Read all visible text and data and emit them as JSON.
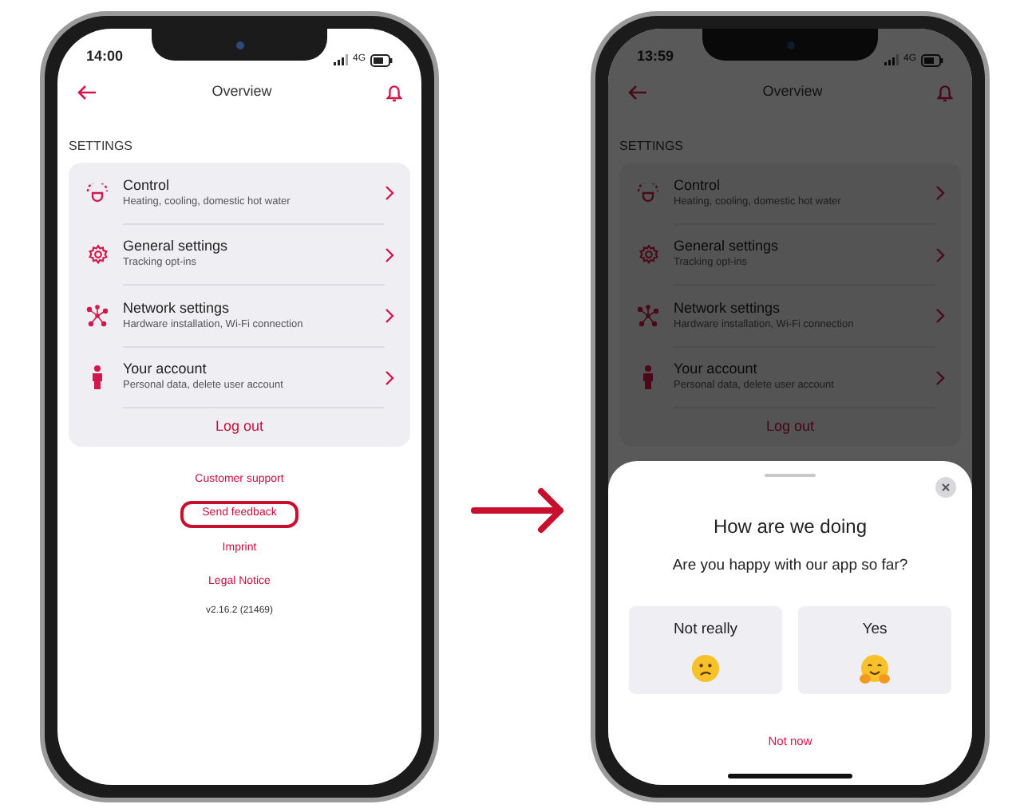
{
  "phones": [
    {
      "status_bar": {
        "time": "14:00",
        "network": "4G"
      },
      "dimmed": false,
      "nav": {
        "title": "Overview"
      },
      "section": "SETTINGS",
      "items": [
        {
          "kind": "control",
          "title": "Control",
          "subtitle": "Heating, cooling, domestic hot water"
        },
        {
          "kind": "general",
          "title": "General settings",
          "subtitle": "Tracking opt-ins"
        },
        {
          "kind": "network",
          "title": "Network settings",
          "subtitle": "Hardware installation, Wi-Fi connection"
        },
        {
          "kind": "account",
          "title": "Your account",
          "subtitle": "Personal data, delete user account"
        }
      ],
      "logout": "Log out",
      "links": [
        {
          "label": "Customer support",
          "highlighted": false
        },
        {
          "label": "Send feedback",
          "highlighted": true
        },
        {
          "label": "Imprint",
          "highlighted": false
        },
        {
          "label": "Legal Notice",
          "highlighted": false
        }
      ],
      "version": "v2.16.2 (21469)"
    },
    {
      "status_bar": {
        "time": "13:59",
        "network": "4G"
      },
      "dimmed": true,
      "nav": {
        "title": "Overview"
      },
      "section": "SETTINGS",
      "items": [
        {
          "kind": "control",
          "title": "Control",
          "subtitle": "Heating, cooling, domestic hot water"
        },
        {
          "kind": "general",
          "title": "General settings",
          "subtitle": "Tracking opt-ins"
        },
        {
          "kind": "network",
          "title": "Network settings",
          "subtitle": "Hardware installation, Wi-Fi connection"
        },
        {
          "kind": "account",
          "title": "Your account",
          "subtitle": "Personal data, delete user account"
        }
      ],
      "logout": "Log out",
      "sheet": {
        "title": "How are we doing",
        "question": "Are you happy with our app so far?",
        "options": [
          {
            "kind": "confused",
            "label": "Not really"
          },
          {
            "kind": "hug",
            "label": "Yes"
          }
        ],
        "dismiss": "Not now"
      }
    }
  ]
}
